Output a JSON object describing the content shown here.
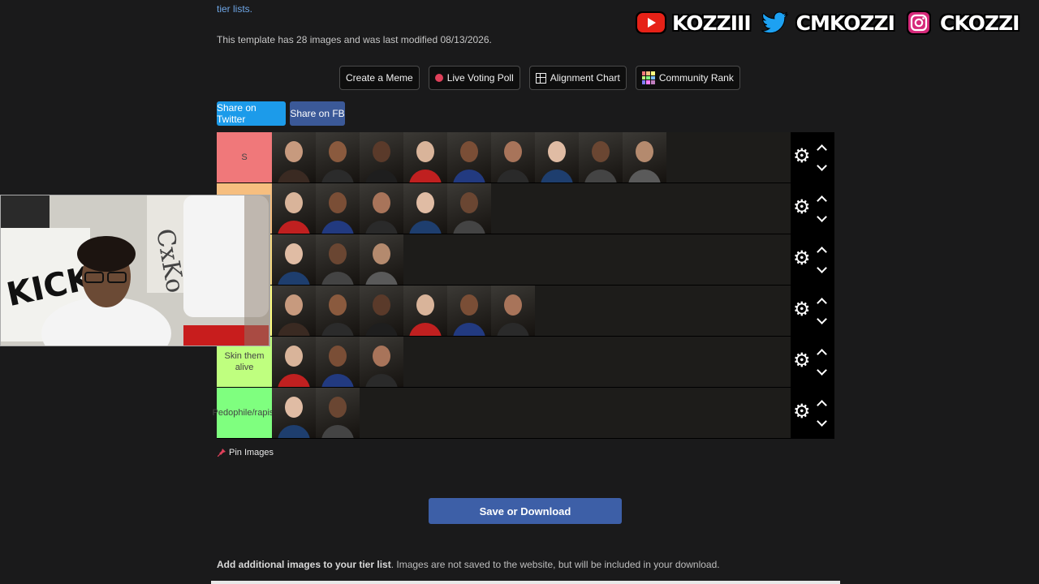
{
  "header": {
    "link_text": "tier lists.",
    "template_info": "This template has 28 images and was last modified 08/13/2026."
  },
  "socials": [
    {
      "icon": "youtube-icon",
      "handle": "KOZZIII",
      "color": "#e62117"
    },
    {
      "icon": "twitter-icon",
      "handle": "CMKOZZI",
      "color": "#1da1f2"
    },
    {
      "icon": "instagram-icon",
      "handle": "CKOZZI",
      "color": "#d6297a"
    }
  ],
  "actions": {
    "create_meme": "Create a Meme",
    "live_voting": "Live Voting Poll",
    "alignment_chart": "Alignment Chart",
    "community_rank": "Community Rank"
  },
  "share": {
    "twitter": "Share on Twitter",
    "fb": "Share on FB"
  },
  "tiers": [
    {
      "label": "S",
      "color": "#f0787a",
      "image_count": 9
    },
    {
      "label": "",
      "color": "#f6be7f",
      "image_count": 5
    },
    {
      "label": "",
      "color": "#f6d97f",
      "image_count": 3
    },
    {
      "label": "",
      "color": "#ffff7f",
      "image_count": 6
    },
    {
      "label": "Skin them alive",
      "color": "#bfff7f",
      "image_count": 3
    },
    {
      "label": "Pedophile/rapist",
      "color": "#7fff7f",
      "image_count": 2
    }
  ],
  "pin_images": "Pin Images",
  "save_download": "Save or Download",
  "add_images": {
    "bold": "Add additional images to your tier list",
    "rest": ". Images are not saved to the website, but will be included in your download."
  }
}
